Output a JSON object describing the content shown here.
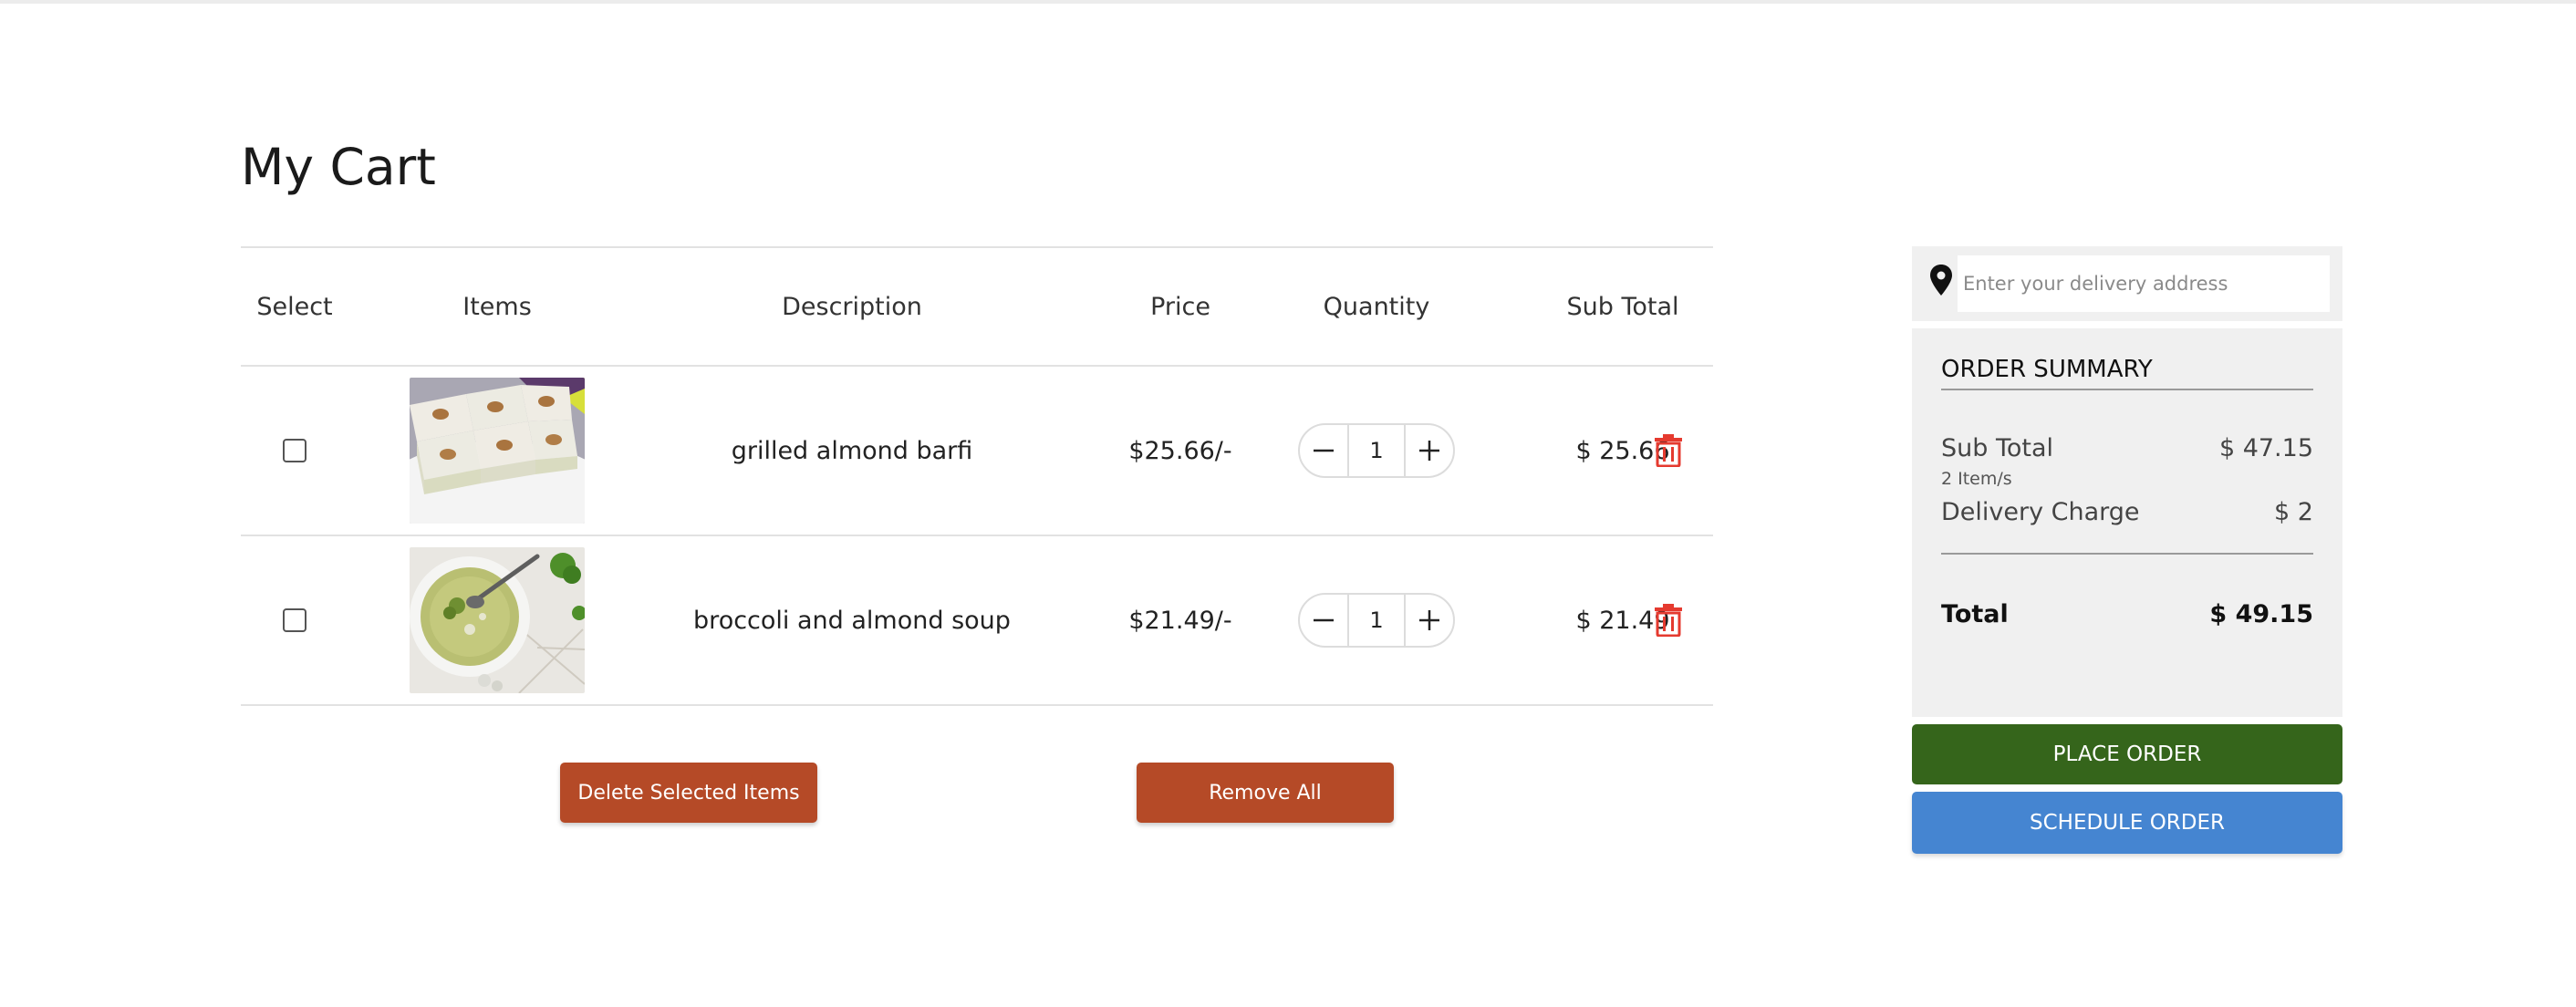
{
  "page": {
    "title": "My Cart"
  },
  "table": {
    "headers": {
      "select": "Select",
      "items": "Items",
      "description": "Description",
      "price": "Price",
      "quantity": "Quantity",
      "subtotal": "Sub Total"
    },
    "rows": [
      {
        "description": "grilled almond barfi",
        "price": "$25.66/-",
        "quantity": "1",
        "subtotal": "$ 25.66",
        "selected": false,
        "image": "almond-barfi-image"
      },
      {
        "description": "broccoli and almond soup",
        "price": "$21.49/-",
        "quantity": "1",
        "subtotal": "$ 21.49",
        "selected": false,
        "image": "broccoli-soup-image"
      }
    ]
  },
  "actions": {
    "delete_selected": "Delete Selected Items",
    "remove_all": "Remove All"
  },
  "address": {
    "placeholder": "Enter your delivery address",
    "icon": "map-pin-icon"
  },
  "summary": {
    "title": "ORDER SUMMARY",
    "subtotal_label": "Sub Total",
    "subtotal_value": "$ 47.15",
    "items_count": "2 Item/s",
    "delivery_label": "Delivery Charge",
    "delivery_value": "$ 2",
    "total_label": "Total",
    "total_value": "$ 49.15"
  },
  "buttons": {
    "place_order": "PLACE ORDER",
    "schedule_order": "SCHEDULE ORDER"
  },
  "colors": {
    "orange_button": "#b54a27",
    "place_order": "#35651b",
    "schedule_order": "#4585d1",
    "trash_icon": "#e53a2f",
    "panel_bg": "#f0f0f0"
  }
}
